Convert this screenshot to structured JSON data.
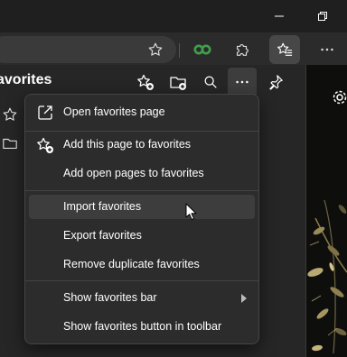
{
  "window": {
    "controls": [
      "minimize",
      "restore"
    ]
  },
  "toolbar": {
    "icons": [
      "star-outline-icon",
      "copilot-icon",
      "extensions-icon",
      "favorites-icon",
      "more-icon"
    ]
  },
  "favorites_panel": {
    "title": "avorites",
    "header_icons": [
      "add-favorite-icon",
      "add-folder-icon",
      "search-icon",
      "more-icon",
      "pin-icon"
    ]
  },
  "menu": {
    "items": [
      {
        "label": "Open favorites page"
      },
      {
        "label": "Add this page to favorites"
      },
      {
        "label": "Add open pages to favorites"
      },
      {
        "label": "Import favorites"
      },
      {
        "label": "Export favorites"
      },
      {
        "label": "Remove duplicate favorites"
      },
      {
        "label": "Show favorites bar"
      },
      {
        "label": "Show favorites button in toolbar"
      }
    ],
    "hovered": "Import favorites"
  },
  "colors": {
    "background": "#1f1f1f",
    "menu": "#2c2c2c",
    "hover": "#3d3d3d",
    "accent": "#3fa04a"
  }
}
